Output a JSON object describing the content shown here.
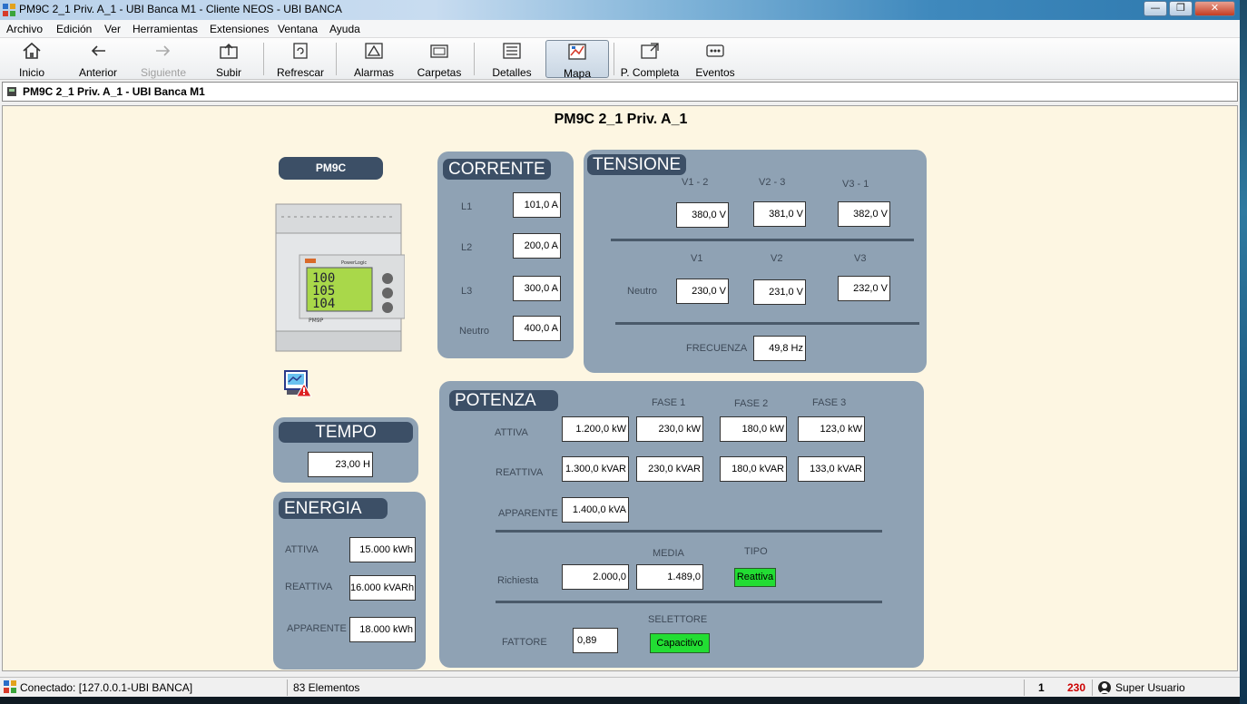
{
  "window": {
    "title": "PM9C 2_1 Priv. A_1 - UBI Banca M1 - Cliente NEOS - UBI BANCA",
    "controls": {
      "minimize": "—",
      "maximize": "❐",
      "close": "✕"
    }
  },
  "menu": [
    "Archivo",
    "Edición",
    "Ver",
    "Herramientas",
    "Extensiones",
    "Ventana",
    "Ayuda"
  ],
  "toolbar": {
    "inicio": "Inicio",
    "anterior": "Anterior",
    "siguiente": "Siguiente",
    "subir": "Subir",
    "refrescar": "Refrescar",
    "alarmas": "Alarmas",
    "carpetas": "Carpetas",
    "detalles": "Detalles",
    "mapa": "Mapa",
    "p_completa": "P. Completa",
    "eventos": "Eventos",
    "active": "mapa"
  },
  "location": "PM9C 2_1 Priv. A_1 - UBI Banca M1",
  "page_title": "PM9C 2_1 Priv. A_1",
  "device": {
    "label": "PM9C",
    "model_text": "PM9P",
    "brand_text": "PowerLogic",
    "lcd": [
      "100",
      "105",
      "104"
    ]
  },
  "corrente": {
    "title": "CORRENTE",
    "rows": [
      {
        "label": "L1",
        "value": "101,0 A"
      },
      {
        "label": "L2",
        "value": "200,0 A"
      },
      {
        "label": "L3",
        "value": "300,0 A"
      },
      {
        "label": "Neutro",
        "value": "400,0 A"
      }
    ]
  },
  "tensione": {
    "title": "TENSIONE",
    "line_headers": [
      "V1 - 2",
      "V2 - 3",
      "V3 - 1"
    ],
    "line_values": [
      "380,0 V",
      "381,0 V",
      "382,0 V"
    ],
    "phase_headers": [
      "V1",
      "V2",
      "V3"
    ],
    "neutro_label": "Neutro",
    "phase_values": [
      "230,0 V",
      "231,0 V",
      "232,0 V"
    ],
    "freq_label": "FRECUENZA",
    "freq_value": "49,8 Hz"
  },
  "tempo": {
    "title": "TEMPO",
    "value": "23,00 H"
  },
  "energia": {
    "title": "ENERGIA",
    "rows": [
      {
        "label": "ATTIVA",
        "value": "15.000 kWh"
      },
      {
        "label": "REATTIVA",
        "value": "16.000 kVARh"
      },
      {
        "label": "APPARENTE",
        "value": "18.000 kWh"
      }
    ]
  },
  "potenza": {
    "title": "POTENZA",
    "phase_headers": [
      "FASE 1",
      "FASE 2",
      "FASE 3"
    ],
    "attiva_label": "ATTIVA",
    "attiva_values": [
      "1.200,0 kW",
      "230,0 kW",
      "180,0 kW",
      "123,0 kW"
    ],
    "reattiva_label": "REATTIVA",
    "reattiva_values": [
      "1.300,0 kVAR",
      "230,0 kVAR",
      "180,0 kVAR",
      "133,0 kVAR"
    ],
    "apparente_label": "APPARENTE",
    "apparente_value": "1.400,0 kVA",
    "media_header": "MEDIA",
    "tipo_header": "TIPO",
    "richiesta_label": "Richiesta",
    "richiesta_value": "2.000,0",
    "media_value": "1.489,0",
    "tipo_value": "Reattiva",
    "selettore_header": "SELETTORE",
    "fattore_label": "FATTORE",
    "fattore_value": "0,89",
    "selettore_value": "Capacitivo"
  },
  "status": {
    "connection": "Conectado: [127.0.0.1-UBI BANCA]",
    "elements": "83 Elementos",
    "count": "1",
    "alarm_count": "230",
    "user": "Super Usuario"
  },
  "colors": {
    "panel": "#8fa2b4",
    "panel_title": "#3c4f66",
    "canvas": "#fdf6e2",
    "green_badge": "#22dd33",
    "alarm_red": "#cc0000"
  }
}
